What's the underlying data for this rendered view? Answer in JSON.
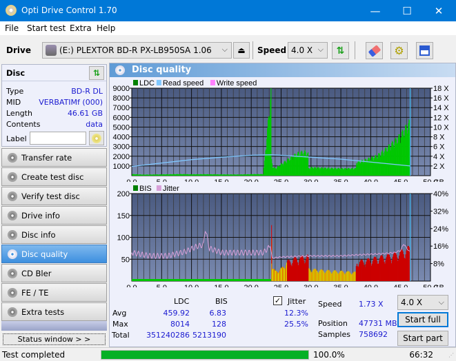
{
  "window": {
    "title": "Opti Drive Control 1.70",
    "minimize": "—",
    "maximize": "☐",
    "close": "✕"
  },
  "menu": [
    "File",
    "Start test",
    "Extra",
    "Help"
  ],
  "toolbar": {
    "drive_label": "Drive",
    "drive_value": "(E:)  PLEXTOR BD-R  PX-LB950SA 1.06",
    "speed_label": "Speed",
    "speed_value": "4.0 X"
  },
  "disc": {
    "header": "Disc",
    "type_label": "Type",
    "type_value": "BD-R DL",
    "mid_label": "MID",
    "mid_value": "VERBATIMf (000)",
    "length_label": "Length",
    "length_value": "46.61 GB",
    "contents_label": "Contents",
    "contents_value": "data",
    "label_label": "Label",
    "label_value": ""
  },
  "nav": [
    {
      "label": "Transfer rate",
      "active": false
    },
    {
      "label": "Create test disc",
      "active": false
    },
    {
      "label": "Verify test disc",
      "active": false
    },
    {
      "label": "Drive info",
      "active": false
    },
    {
      "label": "Disc info",
      "active": false
    },
    {
      "label": "Disc quality",
      "active": true
    },
    {
      "label": "CD Bler",
      "active": false
    },
    {
      "label": "FE / TE",
      "active": false
    },
    {
      "label": "Extra tests",
      "active": false
    }
  ],
  "status_window_label": "Status window > >",
  "main": {
    "title": "Disc quality"
  },
  "chart_data": [
    {
      "type": "area",
      "title": "LDC / Read speed",
      "legend": [
        {
          "name": "LDC",
          "color": "#008000"
        },
        {
          "name": "Read speed",
          "color": "#80c8ff"
        },
        {
          "name": "Write speed",
          "color": "#ff80ff"
        }
      ],
      "xlabel": "GB",
      "x_ticks": [
        "0.0",
        "5.0",
        "10.0",
        "15.0",
        "20.0",
        "25.0",
        "30.0",
        "35.0",
        "40.0",
        "45.0",
        "50.0"
      ],
      "xlim": [
        0,
        50
      ],
      "y_ticks_left": [
        "1000",
        "2000",
        "3000",
        "4000",
        "5000",
        "6000",
        "7000",
        "8000",
        "9000"
      ],
      "ylim_left": [
        0,
        9000
      ],
      "y_ticks_right": [
        "2 X",
        "4 X",
        "6 X",
        "8 X",
        "10 X",
        "12 X",
        "14 X",
        "16 X",
        "18 X"
      ],
      "ylim_right": [
        0,
        18
      ],
      "series": [
        {
          "name": "LDC",
          "x": [
            0,
            2,
            5,
            8,
            10,
            12,
            15,
            18,
            20,
            22,
            23.3,
            23.4,
            23.6,
            24,
            25,
            26,
            27,
            28,
            29,
            29.5,
            29.6,
            30,
            32,
            35,
            37.5,
            37.6,
            39,
            40,
            41,
            42,
            43,
            44,
            45,
            46,
            46.6
          ],
          "values": [
            150,
            100,
            120,
            150,
            130,
            140,
            120,
            110,
            140,
            150,
            8014,
            1500,
            900,
            700,
            1100,
            1500,
            1900,
            2200,
            2300,
            2100,
            700,
            800,
            750,
            700,
            700,
            1300,
            1500,
            1700,
            1900,
            2300,
            2800,
            3300,
            3900,
            4700,
            5200
          ]
        },
        {
          "name": "Read speed",
          "x": [
            0,
            5,
            10,
            15,
            20,
            23.3,
            25,
            30,
            35,
            40,
            45,
            46.6
          ],
          "values": [
            1.9,
            2.6,
            3.3,
            3.8,
            4.2,
            4.3,
            4.2,
            3.8,
            3.4,
            2.8,
            2.2,
            2.0
          ]
        }
      ]
    },
    {
      "type": "area",
      "title": "BIS / Jitter",
      "legend": [
        {
          "name": "BIS",
          "color": "#008000"
        },
        {
          "name": "Jitter",
          "color": "#d8a0d8"
        }
      ],
      "xlabel": "GB",
      "x_ticks": [
        "0.0",
        "5.0",
        "10.0",
        "15.0",
        "20.0",
        "25.0",
        "30.0",
        "35.0",
        "40.0",
        "45.0",
        "50.0"
      ],
      "xlim": [
        0,
        50
      ],
      "y_ticks_left": [
        "50",
        "100",
        "150",
        "200"
      ],
      "ylim_left": [
        0,
        200
      ],
      "y_ticks_right": [
        "8%",
        "16%",
        "24%",
        "32%",
        "40%"
      ],
      "ylim_right": [
        0,
        40
      ],
      "series": [
        {
          "name": "BIS",
          "x": [
            0,
            10,
            20,
            23.3,
            23.4,
            23.5,
            24,
            25,
            26,
            27,
            28,
            29,
            29.5,
            29.6,
            32,
            35,
            37.5,
            37.6,
            39,
            40,
            42,
            44,
            45,
            46,
            46.6
          ],
          "values": [
            2,
            2,
            2,
            2,
            128,
            30,
            20,
            25,
            40,
            45,
            48,
            50,
            52,
            25,
            22,
            20,
            18,
            40,
            42,
            45,
            50,
            55,
            60,
            65,
            70
          ]
        },
        {
          "name": "Jitter",
          "x": [
            0,
            3,
            6,
            9,
            11,
            12,
            12.3,
            13,
            15,
            18,
            22,
            23.2,
            23.5,
            25,
            30,
            35,
            38,
            42,
            44,
            45,
            45.5,
            46.6
          ],
          "values": [
            13,
            11.5,
            11.5,
            13.5,
            16,
            16.5,
            24,
            15,
            13,
            13,
            13,
            16,
            10.5,
            11,
            11.5,
            11.5,
            12,
            12.5,
            13,
            14,
            17,
            13
          ]
        }
      ]
    }
  ],
  "stats": {
    "ldc_header": "LDC",
    "bis_header": "BIS",
    "avg_label": "Avg",
    "max_label": "Max",
    "total_label": "Total",
    "ldc_avg": "459.92",
    "ldc_max": "8014",
    "ldc_total": "351240286",
    "bis_avg": "6.83",
    "bis_max": "128",
    "bis_total": "5213190",
    "jitter_label": "Jitter",
    "jitter_checked": true,
    "jitter_avg": "12.3%",
    "jitter_max": "25.5%",
    "speed_label": "Speed",
    "speed_value": "1.73 X",
    "position_label": "Position",
    "position_value": "47731 MB",
    "samples_label": "Samples",
    "samples_value": "758692",
    "speed_select": "4.0 X",
    "start_full": "Start full",
    "start_part": "Start part"
  },
  "statusbar": {
    "text": "Test completed",
    "progress": 100.0,
    "progress_text": "100.0%",
    "time": "66:32"
  }
}
